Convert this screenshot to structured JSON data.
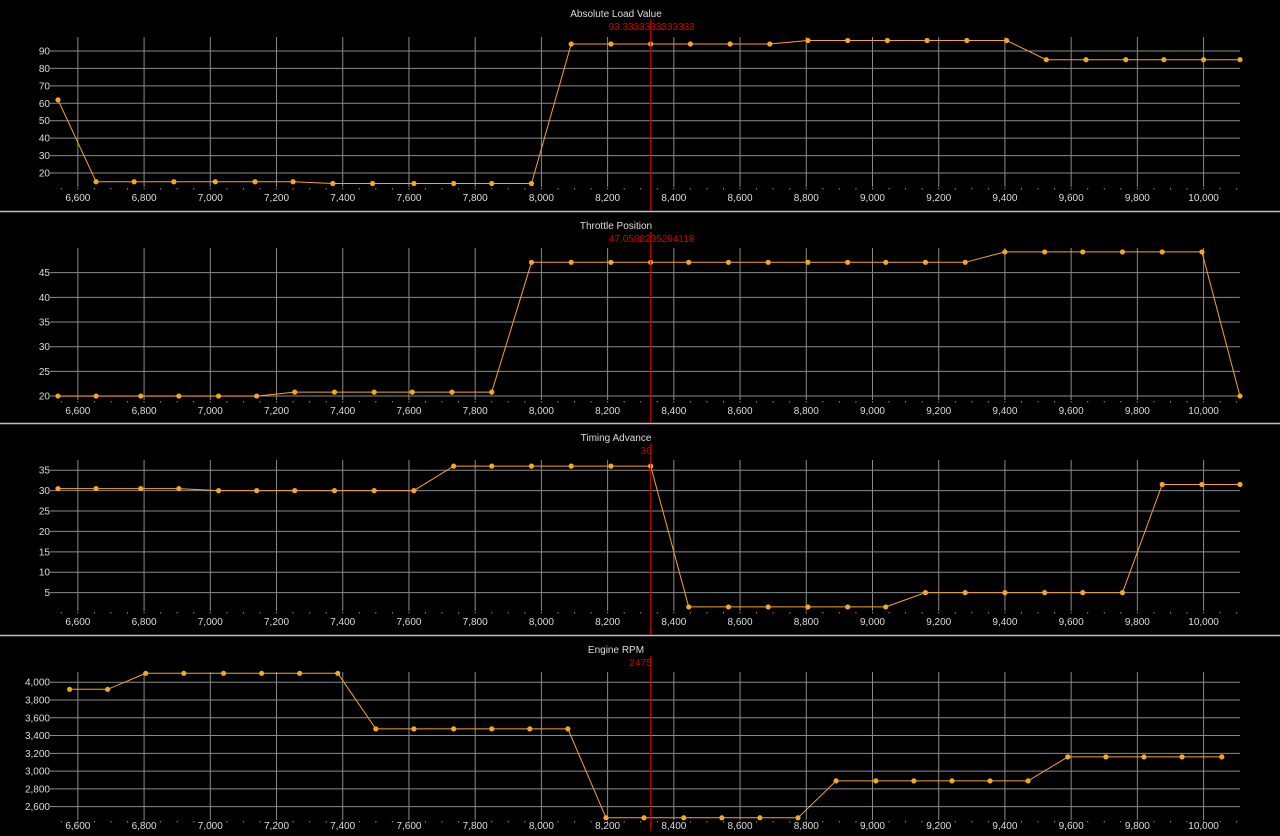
{
  "theme": {
    "background": "#000000",
    "grid": "#8a8a8a",
    "separator": "#bdbdbd",
    "series": "#f5a623",
    "cursor": "#d10000",
    "text": "#dddddd"
  },
  "chart_data": [
    {
      "type": "line",
      "title": "Absolute Load Value",
      "cursor_label": "93.3333333333333",
      "cursor_x": 8330,
      "xlim": [
        6540,
        10110
      ],
      "ylim": [
        12,
        98
      ],
      "xticks": [
        6600,
        6800,
        7000,
        7200,
        7400,
        7600,
        7800,
        8000,
        8200,
        8400,
        8600,
        8800,
        9000,
        9200,
        9400,
        9600,
        9800,
        10000
      ],
      "xtick_labels": [
        "6,600",
        "6,800",
        "7,000",
        "7,200",
        "7,400",
        "7,600",
        "7,800",
        "8,000",
        "8,200",
        "8,400",
        "8,600",
        "8,800",
        "9,000",
        "9,200",
        "9,400",
        "9,600",
        "9,800",
        "10,000"
      ],
      "yticks": [
        20,
        30,
        40,
        50,
        60,
        70,
        80,
        90
      ],
      "ytick_labels": [
        "20",
        "30",
        "40",
        "50",
        "60",
        "70",
        "80",
        "90"
      ],
      "x": [
        6540,
        6655,
        6770,
        6890,
        7015,
        7135,
        7250,
        7370,
        7490,
        7615,
        7735,
        7850,
        7970,
        8090,
        8210,
        8330,
        8450,
        8570,
        8690,
        8805,
        8925,
        9045,
        9165,
        9285,
        9405,
        9525,
        9645,
        9765,
        9880,
        10000,
        10110
      ],
      "y": [
        62,
        15,
        15,
        15,
        15,
        15,
        15,
        14,
        14,
        14,
        14,
        14,
        14,
        94,
        94,
        94,
        94,
        94,
        94,
        96,
        96,
        96,
        96,
        96,
        96,
        85,
        85,
        85,
        85,
        85,
        85
      ]
    },
    {
      "type": "line",
      "title": "Throttle Position",
      "cursor_label": "47.0588235294118",
      "cursor_x": 8330,
      "xlim": [
        6540,
        10110
      ],
      "ylim": [
        19.2,
        50
      ],
      "xticks": [
        6600,
        6800,
        7000,
        7200,
        7400,
        7600,
        7800,
        8000,
        8200,
        8400,
        8600,
        8800,
        9000,
        9200,
        9400,
        9600,
        9800,
        10000
      ],
      "xtick_labels": [
        "6,600",
        "6,800",
        "7,000",
        "7,200",
        "7,400",
        "7,600",
        "7,800",
        "8,000",
        "8,200",
        "8,400",
        "8,600",
        "8,800",
        "9,000",
        "9,200",
        "9,400",
        "9,600",
        "9,800",
        "10,000"
      ],
      "yticks": [
        20,
        25,
        30,
        35,
        40,
        45
      ],
      "ytick_labels": [
        "20",
        "25",
        "30",
        "35",
        "40",
        "45"
      ],
      "x": [
        6540,
        6655,
        6790,
        6905,
        7025,
        7140,
        7255,
        7375,
        7495,
        7610,
        7730,
        7850,
        7970,
        8090,
        8210,
        8330,
        8445,
        8565,
        8685,
        8805,
        8925,
        9040,
        9160,
        9280,
        9400,
        9520,
        9635,
        9755,
        9875,
        9995,
        10110
      ],
      "y": [
        20,
        20,
        20,
        20,
        20,
        20,
        20.8,
        20.8,
        20.8,
        20.8,
        20.8,
        20.8,
        47.1,
        47.1,
        47.1,
        47.1,
        47.1,
        47.1,
        47.1,
        47.1,
        47.1,
        47.1,
        47.1,
        47.1,
        49.2,
        49.2,
        49.2,
        49.2,
        49.2,
        49.2,
        20
      ]
    },
    {
      "type": "line",
      "title": "Timing Advance",
      "cursor_label": "36",
      "cursor_x": 8330,
      "xlim": [
        6540,
        10110
      ],
      "ylim": [
        0.5,
        37.5
      ],
      "xticks": [
        6600,
        6800,
        7000,
        7200,
        7400,
        7600,
        7800,
        8000,
        8200,
        8400,
        8600,
        8800,
        9000,
        9200,
        9400,
        9600,
        9800,
        10000
      ],
      "xtick_labels": [
        "6,600",
        "6,800",
        "7,000",
        "7,200",
        "7,400",
        "7,600",
        "7,800",
        "8,000",
        "8,200",
        "8,400",
        "8,600",
        "8,800",
        "9,000",
        "9,200",
        "9,400",
        "9,600",
        "9,800",
        "10,000"
      ],
      "yticks": [
        5,
        10,
        15,
        20,
        25,
        30,
        35
      ],
      "ytick_labels": [
        "5",
        "10",
        "15",
        "20",
        "25",
        "30",
        "35"
      ],
      "x": [
        6540,
        6655,
        6790,
        6905,
        7025,
        7140,
        7255,
        7375,
        7495,
        7615,
        7735,
        7850,
        7970,
        8090,
        8210,
        8330,
        8445,
        8565,
        8685,
        8805,
        8925,
        9040,
        9160,
        9280,
        9400,
        9520,
        9635,
        9755,
        9875,
        9995,
        10110
      ],
      "y": [
        30.5,
        30.5,
        30.5,
        30.5,
        30,
        30,
        30,
        30,
        30,
        30,
        36,
        36,
        36,
        36,
        36,
        36,
        1.5,
        1.5,
        1.5,
        1.5,
        1.5,
        1.5,
        5,
        5,
        5,
        5,
        5,
        5,
        31.5,
        31.5,
        31.5
      ]
    },
    {
      "type": "line",
      "title": "Engine RPM",
      "cursor_label": "2475",
      "cursor_x": 8330,
      "xlim": [
        6540,
        10110
      ],
      "ylim": [
        2450,
        4115
      ],
      "xticks": [
        6600,
        6800,
        7000,
        7200,
        7400,
        7600,
        7800,
        8000,
        8200,
        8400,
        8600,
        8800,
        9000,
        9200,
        9400,
        9600,
        9800,
        10000
      ],
      "xtick_labels": [
        "6,600",
        "6,800",
        "7,000",
        "7,200",
        "7,400",
        "7,600",
        "7,800",
        "8,000",
        "8,200",
        "8,400",
        "8,600",
        "8,800",
        "9,000",
        "9,200",
        "9,400",
        "9,600",
        "9,800",
        "10,000"
      ],
      "yticks": [
        2600,
        2800,
        3000,
        3200,
        3400,
        3600,
        3800,
        4000
      ],
      "ytick_labels": [
        "2,600",
        "2,800",
        "3,000",
        "3,200",
        "3,400",
        "3,600",
        "3,800",
        "4,000"
      ],
      "x": [
        6575,
        6690,
        6805,
        6920,
        7040,
        7155,
        7270,
        7385,
        7500,
        7615,
        7735,
        7850,
        7965,
        8080,
        8195,
        8310,
        8430,
        8545,
        8660,
        8775,
        8890,
        9010,
        9125,
        9240,
        9355,
        9470,
        9590,
        9705,
        9820,
        9935,
        10055
      ],
      "y": [
        3920,
        3920,
        4100,
        4100,
        4100,
        4100,
        4100,
        4100,
        3475,
        3475,
        3475,
        3475,
        3475,
        3475,
        2475,
        2475,
        2475,
        2475,
        2475,
        2475,
        2890,
        2890,
        2890,
        2890,
        2890,
        2890,
        3160,
        3160,
        3160,
        3160,
        3160
      ]
    }
  ]
}
